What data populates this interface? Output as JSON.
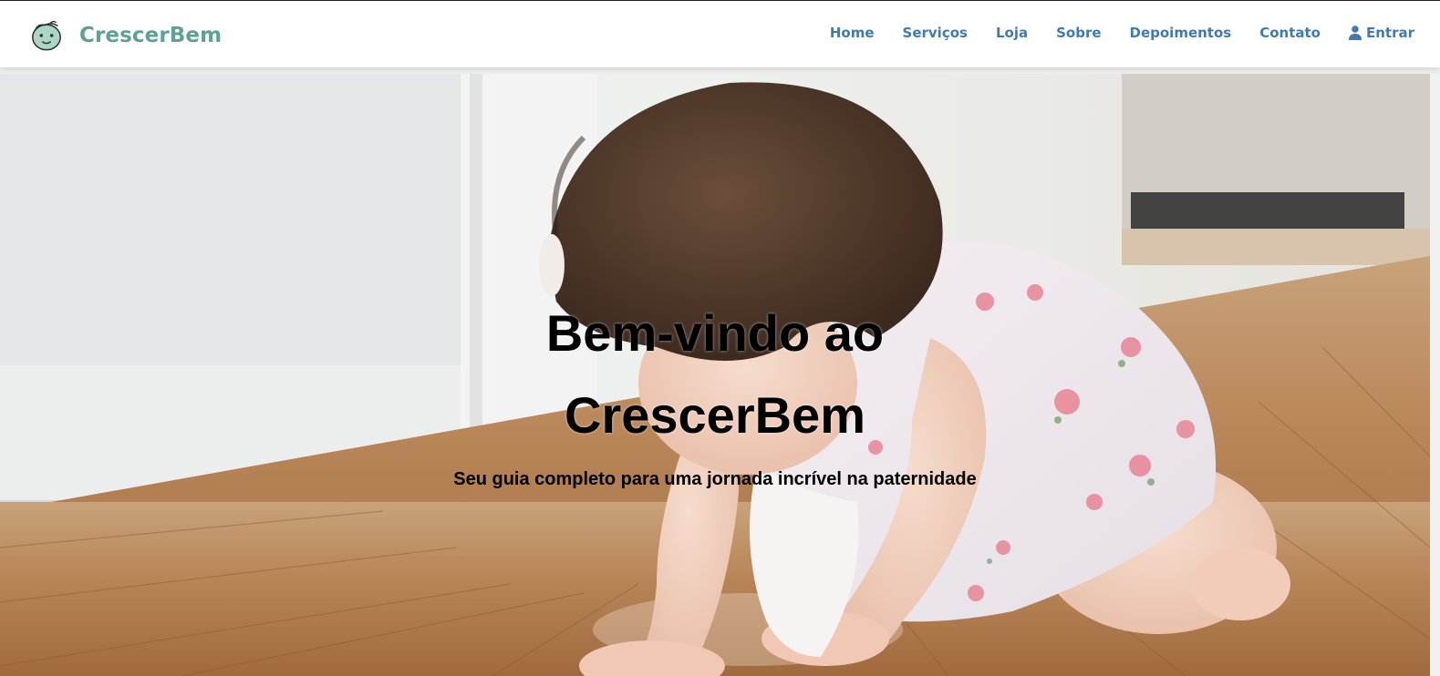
{
  "brand": {
    "name": "CrescerBem",
    "logo_icon": "baby-face-icon",
    "color": "#5fa197"
  },
  "nav": {
    "items": [
      {
        "label": "Home"
      },
      {
        "label": "Serviços"
      },
      {
        "label": "Loja"
      },
      {
        "label": "Sobre"
      },
      {
        "label": "Depoimentos"
      },
      {
        "label": "Contato"
      }
    ],
    "login": {
      "label": "Entrar",
      "icon": "user-icon"
    },
    "link_color": "#3f7bb0"
  },
  "hero": {
    "title": "Bem-vindo ao CrescerBem",
    "subtitle": "Seu guia completo para uma jornada incrível na paternidade",
    "image": "baby-crawling-on-wood-floor"
  }
}
